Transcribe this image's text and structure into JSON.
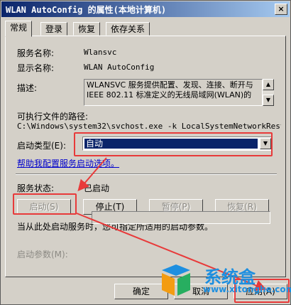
{
  "window": {
    "title": "WLAN AutoConfig 的属性(本地计算机)",
    "close_glyph": "×"
  },
  "tabs": [
    {
      "label": "常规"
    },
    {
      "label": "登录"
    },
    {
      "label": "恢复"
    },
    {
      "label": "依存关系"
    }
  ],
  "general": {
    "service_name_label": "服务名称:",
    "service_name_value": "Wlansvc",
    "display_name_label": "显示名称:",
    "display_name_value": "WLAN AutoConfig",
    "description_label": "描述:",
    "description_line1": "WLANSVC 服务提供配置、发现、连接、断开与",
    "description_line2": "IEEE 802.11 标准定义的无线局域网(WLAN)的",
    "path_label": "可执行文件的路径:",
    "path_value": "C:\\Windows\\system32\\svchost.exe -k LocalSystemNetworkRestric",
    "startup_type_label": "启动类型(E):",
    "startup_type_value": "自动",
    "help_link": "帮助我配置服务启动选项。",
    "status_label": "服务状态:",
    "status_value": "已启动",
    "start_button": "启动(S)",
    "stop_button": "停止(T)",
    "pause_button": "暂停(P)",
    "resume_button": "恢复(R)",
    "hint_text": "当从此处启动服务时，您可指定所适用的启动参数。",
    "start_params_label": "启动参数(M):"
  },
  "footer": {
    "ok_button": "确定",
    "cancel_button": "取消",
    "apply_button": "应用(A)"
  },
  "watermark": {
    "brand": "系统盒",
    "url": "www.xitonghe.com"
  },
  "colors": {
    "highlight": "#e83a3a",
    "selection": "#0a246a",
    "link": "#0000cc",
    "watermark": "#1e8fe0"
  }
}
